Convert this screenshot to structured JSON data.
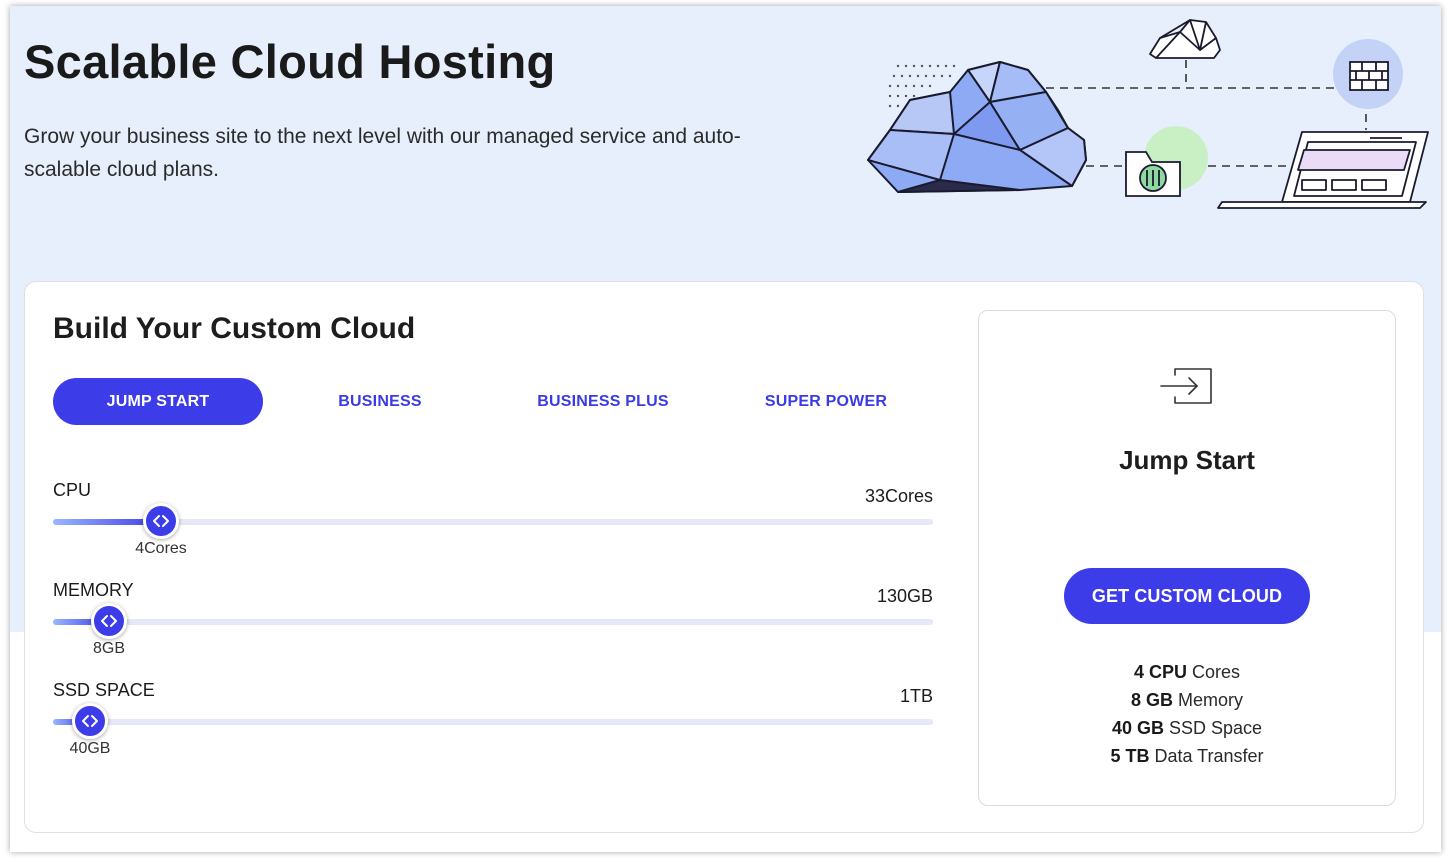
{
  "hero": {
    "title": "Scalable Cloud Hosting",
    "subtitle": "Grow your business site to the next level with our managed service and auto-scalable cloud plans."
  },
  "builder": {
    "title": "Build Your Custom Cloud",
    "tabs": [
      {
        "label": "JUMP START",
        "active": true
      },
      {
        "label": "BUSINESS",
        "active": false
      },
      {
        "label": "BUSINESS PLUS",
        "active": false
      },
      {
        "label": "SUPER POWER",
        "active": false
      }
    ],
    "sliders": {
      "cpu": {
        "label": "CPU",
        "max_label": "33Cores",
        "value_label": "4Cores",
        "value": 4,
        "min": 1,
        "max": 33
      },
      "memory": {
        "label": "MEMORY",
        "max_label": "130GB",
        "value_label": "8GB",
        "value": 8,
        "min": 2,
        "max": 130
      },
      "ssd": {
        "label": "SSD SPACE",
        "max_label": "1TB",
        "value_label": "40GB",
        "value": 40,
        "min": 20,
        "max": 1000
      }
    }
  },
  "summary": {
    "plan_name": "Jump Start",
    "cta_label": "GET CUSTOM CLOUD",
    "specs": [
      {
        "amount": "4 CPU",
        "unit": "Cores"
      },
      {
        "amount": "8 GB",
        "unit": "Memory"
      },
      {
        "amount": "40 GB",
        "unit": "SSD Space"
      },
      {
        "amount": "5 TB",
        "unit": "Data Transfer"
      }
    ]
  },
  "colors": {
    "accent": "#3c3ce8",
    "hero_background": "#e6effb",
    "cloud_fill": "#8faaf5"
  },
  "icons": {
    "illustration": "cloud-network-illustration",
    "summary": "sign-in-arrow-icon",
    "slider_thumb": "chevrons-left-right-icon"
  }
}
